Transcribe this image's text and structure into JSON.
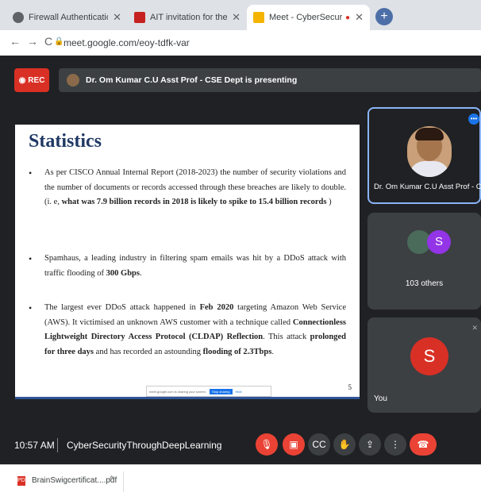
{
  "browser": {
    "tabs": [
      {
        "title": "Firewall Authentication Keepaliv",
        "favicon_color": "#5f6368"
      },
      {
        "title": "AIT invitation for the Workshop",
        "favicon_color": "#c5221f"
      },
      {
        "title": "Meet - CyberSecurityThroug",
        "favicon_color": "#f4b400",
        "active": true
      }
    ],
    "new_tab": "+",
    "address": "meet.google.com/eoy-tdfk-var",
    "nav_back": "←",
    "nav_forward": "→",
    "nav_reload": "C"
  },
  "meet": {
    "rec_label": "REC",
    "presenting_text": "Dr. Om Kumar C.U Asst Prof - CSE Dept is presenting",
    "slide": {
      "title": "Statistics",
      "bullet1_text": "As per CISCO Annual Internal Report (2018-2023) the number of security violations and the number of documents or records accessed through these breaches are likely to double. (i. e, ",
      "bullet1_bold": "what was 7.9 billion records in 2018 is likely to spike to 15.4 billion records",
      "bullet1_end": " )",
      "bullet2_text": "Spamhaus, a leading industry in filtering spam emails was hit by a DDoS attack with traffic flooding of ",
      "bullet2_bold": "300 Gbps",
      "bullet2_end": ".",
      "bullet3_a": "The largest ever DDoS attack happened in ",
      "bullet3_b": "Feb 2020",
      "bullet3_c": " targeting Amazon Web Service (AWS). It victimised an unknown AWS customer with a technique called ",
      "bullet3_d": "Connectionless Lightweight Directory Access Protocol (CLDAP) Reflection",
      "bullet3_e": ". This attack ",
      "bullet3_f": "prolonged for three days",
      "bullet3_g": " and has recorded an astounding ",
      "bullet3_h": "flooding of 2.3Tbps",
      "bullet3_i": ".",
      "page_number": "5",
      "share_text": "meet.google.com is sharing your screen.",
      "stop_sharing": "Stop sharing",
      "hide": "Hide"
    },
    "participants": {
      "presenter_name": "Dr. Om Kumar C.U Asst Prof - CSE",
      "others_initial": "S",
      "others_count": "103 others",
      "self_initial": "S",
      "self_label": "You"
    },
    "time": "10:57 AM",
    "meeting_title": "CyberSecurityThroughDeepLearning"
  },
  "downloads": {
    "file": "BrainSwigcertificat....pdf",
    "pdf_badge": "PDF",
    "caret": "^"
  }
}
